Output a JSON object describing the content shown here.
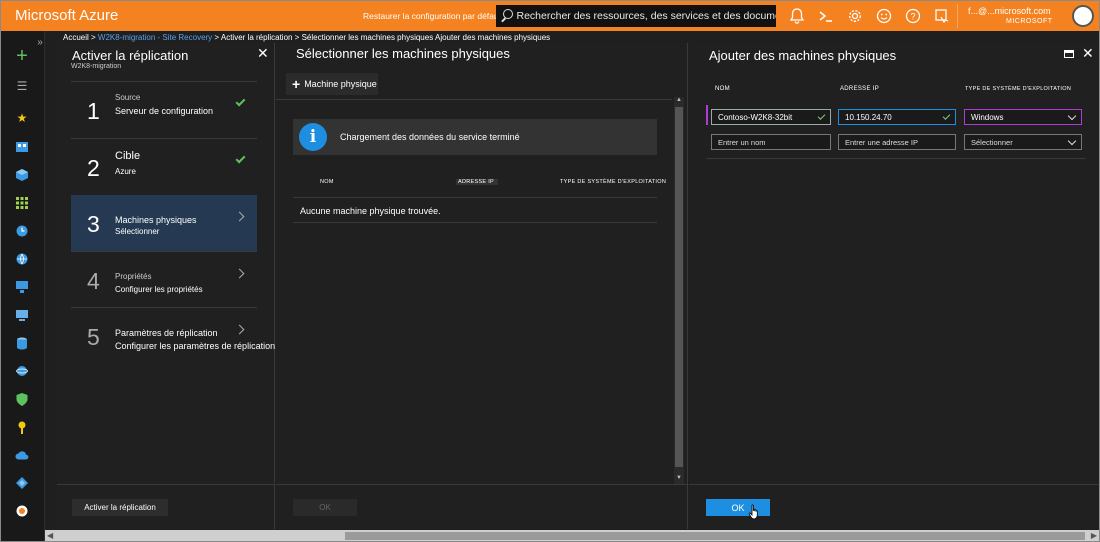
{
  "topbar": {
    "brand": "Microsoft Azure",
    "restore_label": "Restaurer la configuration par défaut",
    "search_placeholder": "Rechercher des ressources, des services et des documents",
    "account_email": "f...@...microsoft.com",
    "account_org": "MICROSOFT",
    "colors": {
      "bar": "#f58220"
    }
  },
  "breadcrumb": {
    "home": "Accueil >",
    "vault": "W2K8-migration - Site Recovery",
    "sep": ">",
    "rest": "Activer la réplication > Sélectionner les machines physiques Ajouter des machines physiques"
  },
  "pane1": {
    "title": "Activer la réplication",
    "subtitle": "W2K8-migration",
    "steps": [
      {
        "num": "1",
        "title": "Source",
        "sub": "Serveur de configuration"
      },
      {
        "num": "2",
        "title": "Cible",
        "sub": "Azure"
      },
      {
        "num": "3",
        "title": "Machines physiques",
        "sub": "Sélectionner"
      },
      {
        "num": "4",
        "title": "Propriétés",
        "sub": "Configurer les propriétés"
      },
      {
        "num": "5",
        "title": "Paramètres de réplication",
        "sub": "Configurer les paramètres de réplication"
      }
    ],
    "enable_button": "Activer la réplication"
  },
  "pane2": {
    "title": "Sélectionner les machines physiques",
    "add_button": "Machine physique",
    "info_message": "Chargement des données du service terminé",
    "columns": [
      "NOM",
      "ADRESSE IP",
      "TYPE DE SYSTÈME D'EXPLOITATION"
    ],
    "empty_message": "Aucune machine physique trouvée.",
    "ok_button": "OK"
  },
  "pane3": {
    "title": "Ajouter des machines physiques",
    "columns": [
      "NOM",
      "ADRESSE IP",
      "TYPE DE SYSTÈME D'EXPLOITATION"
    ],
    "row1": {
      "name": "Contoso-W2K8-32bit",
      "ip": "10.150.24.70",
      "os": "Windows"
    },
    "row2": {
      "name_placeholder": "Entrer un nom",
      "ip_placeholder": "Entrer une adresse IP",
      "os_placeholder": "Sélectionner"
    },
    "ok_button": "OK"
  }
}
